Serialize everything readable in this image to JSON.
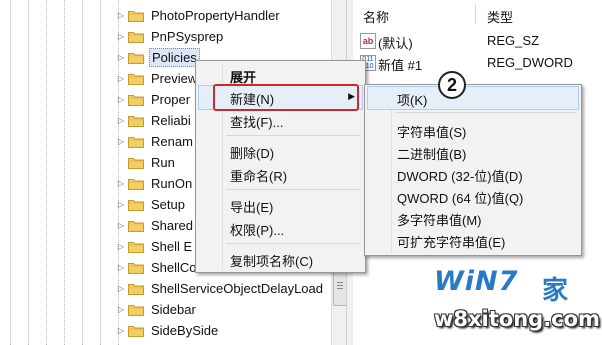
{
  "tree": {
    "items": [
      {
        "label": "PhotoPropertyHandler",
        "expander": "closed"
      },
      {
        "label": "PnPSysprep",
        "expander": "closed"
      },
      {
        "label": "Policies",
        "expander": "closed",
        "selected": true
      },
      {
        "label": "Preview",
        "expander": "closed"
      },
      {
        "label": "Proper",
        "expander": "closed"
      },
      {
        "label": "Reliabi",
        "expander": "closed"
      },
      {
        "label": "Renam",
        "expander": "closed"
      },
      {
        "label": "Run",
        "expander": "none"
      },
      {
        "label": "RunOn",
        "expander": "closed"
      },
      {
        "label": "Setup",
        "expander": "closed"
      },
      {
        "label": "Shared",
        "expander": "closed"
      },
      {
        "label": "Shell E",
        "expander": "closed"
      },
      {
        "label": "ShellCo",
        "expander": "closed"
      },
      {
        "label": "ShellServiceObjectDelayLoad",
        "expander": "closed"
      },
      {
        "label": "Sidebar",
        "expander": "closed"
      },
      {
        "label": "SideBySide",
        "expander": "closed"
      }
    ]
  },
  "values_pane": {
    "col_name": "名称",
    "col_type": "类型",
    "rows": [
      {
        "icon": "string-value-icon",
        "name": "(默认)",
        "type": "REG_SZ"
      },
      {
        "icon": "binary-value-icon",
        "name": "新值 #1",
        "type": "REG_DWORD"
      }
    ]
  },
  "context_menu": {
    "items": {
      "expand": "展开",
      "new": "新建(N)",
      "find": "查找(F)...",
      "delete": "删除(D)",
      "rename": "重命名(R)",
      "export": "导出(E)",
      "permissions": "权限(P)...",
      "copy_name": "复制项名称(C)"
    },
    "submenu_arrow": "▶"
  },
  "submenu": {
    "items": {
      "key": "项(K)",
      "string": "字符串值(S)",
      "binary": "二进制值(B)",
      "dword": "DWORD (32-位)值(D)",
      "qword": "QWORD (64 位)值(Q)",
      "multi": "多字符串值(M)",
      "expand": "可扩充字符串值(E)"
    }
  },
  "callout": {
    "number": "2"
  },
  "watermark": {
    "brand": "WiN7",
    "suffix": "家",
    "url": "w8xitong.com"
  },
  "colors": {
    "highlight": "#e5eef9",
    "callout_box": "#cc2a2a",
    "watermark": "#2a78c8"
  }
}
